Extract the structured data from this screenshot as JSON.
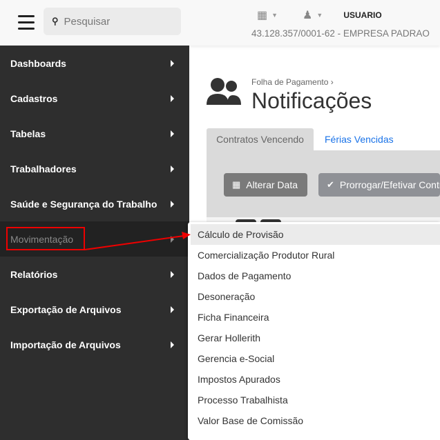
{
  "search": {
    "placeholder": "Pesquisar"
  },
  "header": {
    "user": "USUARIO",
    "company": "43.128.357/0001-62 - EMPRESA PADRAO"
  },
  "sidebar": {
    "items": [
      {
        "label": "Dashboards"
      },
      {
        "label": "Cadastros"
      },
      {
        "label": "Tabelas"
      },
      {
        "label": "Trabalhadores"
      },
      {
        "label": "Saúde e Segurança do Trabalho"
      },
      {
        "label": "Movimentação",
        "active": true
      },
      {
        "label": "Relatórios"
      },
      {
        "label": "Exportação de Arquivos"
      },
      {
        "label": "Importação de Arquivos"
      }
    ]
  },
  "page": {
    "breadcrumb": "Folha de Pagamento",
    "title": "Notificações"
  },
  "tabs": [
    {
      "label": "Contratos Vencendo",
      "active": true
    },
    {
      "label": "Férias Vencidas"
    }
  ],
  "buttons": {
    "alterar": "Alterar Data",
    "prorrogar": "Prorrogar/Efetivar Contratos"
  },
  "submenu": {
    "items": [
      "Cálculo de Provisão",
      "Comercialização Produtor Rural",
      "Dados de Pagamento",
      "Desoneração",
      "Ficha Financeira",
      "Gerar Hollerith",
      "Gerencia e-Social",
      "Impostos Apurados",
      "Processo Trabalhista",
      "Valor Base de Comissão"
    ]
  },
  "colors": {
    "sidebar": "#2e2e2e",
    "highlight": "#e00000",
    "link": "#1a73e8"
  }
}
